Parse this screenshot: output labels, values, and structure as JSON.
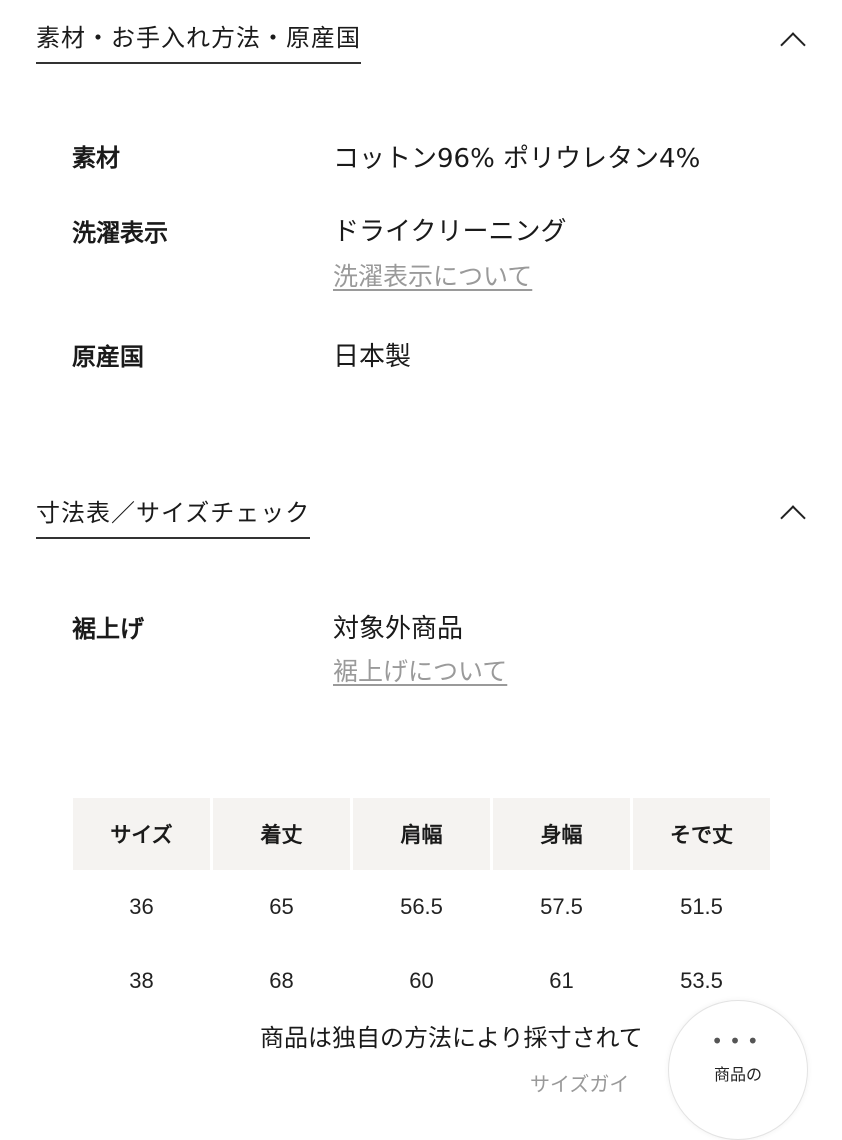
{
  "material_section": {
    "title": "素材・お手入れ方法・原産国",
    "rows": [
      {
        "label": "素材",
        "value": "コットン96% ポリウレタン4%"
      },
      {
        "label": "洗濯表示",
        "value": "ドライクリーニング",
        "link": "洗濯表示について"
      },
      {
        "label": "原産国",
        "value": "日本製"
      }
    ]
  },
  "size_section": {
    "title": "寸法表／サイズチェック",
    "hem": {
      "label": "裾上げ",
      "value": "対象外商品",
      "link": "裾上げについて"
    },
    "table": {
      "headers": [
        "サイズ",
        "着丈",
        "肩幅",
        "身幅",
        "そで丈"
      ],
      "rows": [
        [
          "36",
          "65",
          "56.5",
          "57.5",
          "51.5"
        ],
        [
          "38",
          "68",
          "60",
          "61",
          "53.5"
        ]
      ]
    },
    "note": "商品は独自の方法により採寸されて",
    "sub_note": "サイズガイ"
  },
  "floating_button": {
    "dots": "•••",
    "label": "商品の"
  }
}
